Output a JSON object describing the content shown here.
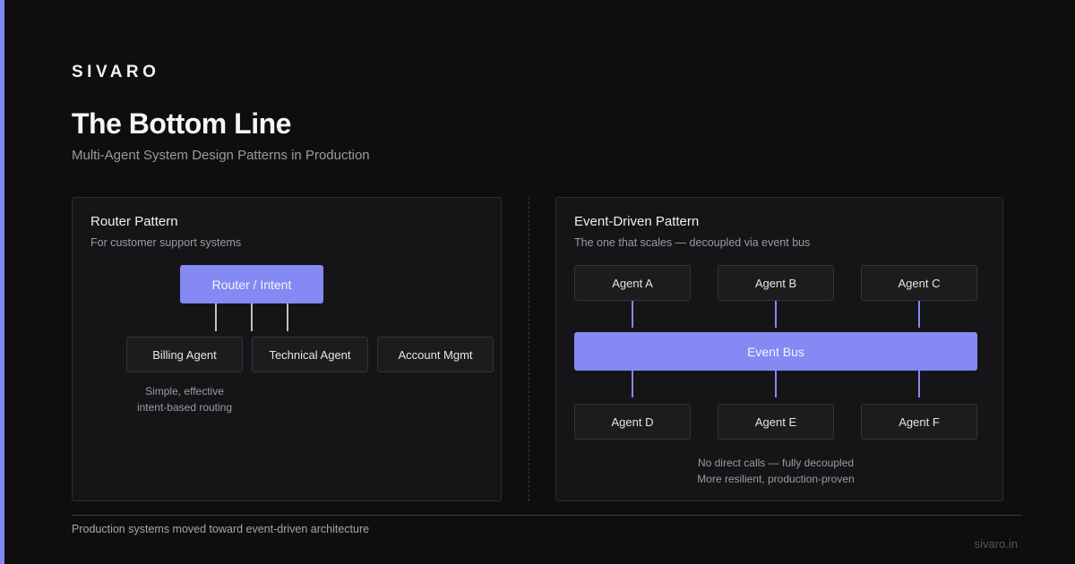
{
  "brand": "SIVARO",
  "title": "The Bottom Line",
  "subtitle": "Multi-Agent System Design Patterns in Production",
  "router": {
    "title": "Router Pattern",
    "subtitle": "For customer support systems",
    "root": "Router / Intent",
    "agents": [
      "Billing Agent",
      "Technical Agent",
      "Account Mgmt"
    ],
    "note_line1": "Simple, effective",
    "note_line2": "intent-based routing"
  },
  "event": {
    "title": "Event-Driven Pattern",
    "subtitle": "The one that scales — decoupled via event bus",
    "top_agents": [
      "Agent A",
      "Agent B",
      "Agent C"
    ],
    "bus": "Event Bus",
    "bottom_agents": [
      "Agent D",
      "Agent E",
      "Agent F"
    ],
    "note_line1": "No direct calls — fully decoupled",
    "note_line2": "More resilient, production-proven"
  },
  "footer": {
    "text": "Production systems moved toward event-driven architecture",
    "site": "sivaro.in"
  },
  "colors": {
    "accent": "#8489f3",
    "background": "#0e0e0f",
    "panel": "#151517"
  }
}
